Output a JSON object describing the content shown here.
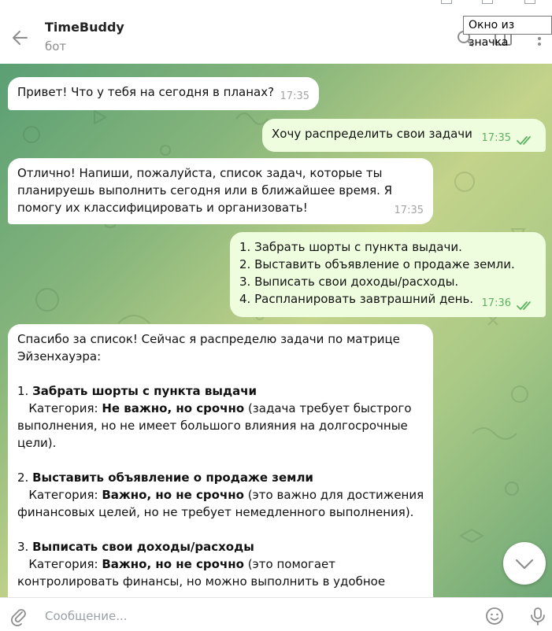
{
  "tooltip": "Окно из значка",
  "header": {
    "title": "TimeBuddy",
    "subtitle": "бот"
  },
  "messages": [
    {
      "dir": "in",
      "text": "Привет! Что у тебя на сегодня в планах?",
      "time": "17:35"
    },
    {
      "dir": "out",
      "text": "Хочу распределить свои задачи",
      "time": "17:35"
    },
    {
      "dir": "in",
      "lines": [
        "Отлично! Напиши, пожалуйста, список задач, которые ты",
        "планируешь выполнить сегодня или в ближайшее время. Я",
        "помогу их классифицировать и организовать!"
      ],
      "time": "17:35"
    },
    {
      "dir": "out",
      "lines": [
        "1. Забрать шорты с пункта выдачи.",
        "2. Выставить объявление о продаже земли.",
        "3. Выписать свои доходы/расходы.",
        "4. Распланировать завтрашний день."
      ],
      "time": "17:36"
    }
  ],
  "long_message": {
    "intro": [
      "Спасибо за список! Сейчас я распределю задачи по матрице",
      "Эйзенхауэра:"
    ],
    "items": [
      {
        "num": "1.",
        "title": "Забрать шорты с пункта выдачи",
        "cat_label": "Категория:",
        "cat_value": "Не важно, но срочно",
        "desc_first": " (задача требует быстрого",
        "desc_rest": [
          "выполнения, но не имеет большого влияния на долгосрочные",
          "цели)."
        ]
      },
      {
        "num": "2.",
        "title": "Выставить объявление о продаже земли",
        "cat_label": "Категория:",
        "cat_value": "Важно, но не срочно",
        "desc_first": " (это важно для достижения",
        "desc_rest": [
          "финансовых целей, но не требует немедленного выполнения)."
        ]
      },
      {
        "num": "3.",
        "title": "Выписать свои доходы/расходы",
        "cat_label": "Категория:",
        "cat_value": "Важно, но не срочно",
        "desc_first": " (это помогает",
        "desc_rest": [
          "контролировать финансы, но можно выполнить в удобное"
        ]
      }
    ]
  },
  "composer": {
    "placeholder": "Сообщение..."
  },
  "icons": [
    "back-arrow-icon",
    "search-icon",
    "sidebar-panel-icon",
    "more-vertical-icon",
    "chevron-down-icon",
    "paperclip-icon",
    "emoji-icon",
    "microphone-icon"
  ],
  "colors": {
    "incoming": "#ffffff",
    "outgoing": "#effddf",
    "read_checks": "#5db25f",
    "wallpaper_start": "#5a9f74",
    "wallpaper_mid": "#c3d38a"
  }
}
